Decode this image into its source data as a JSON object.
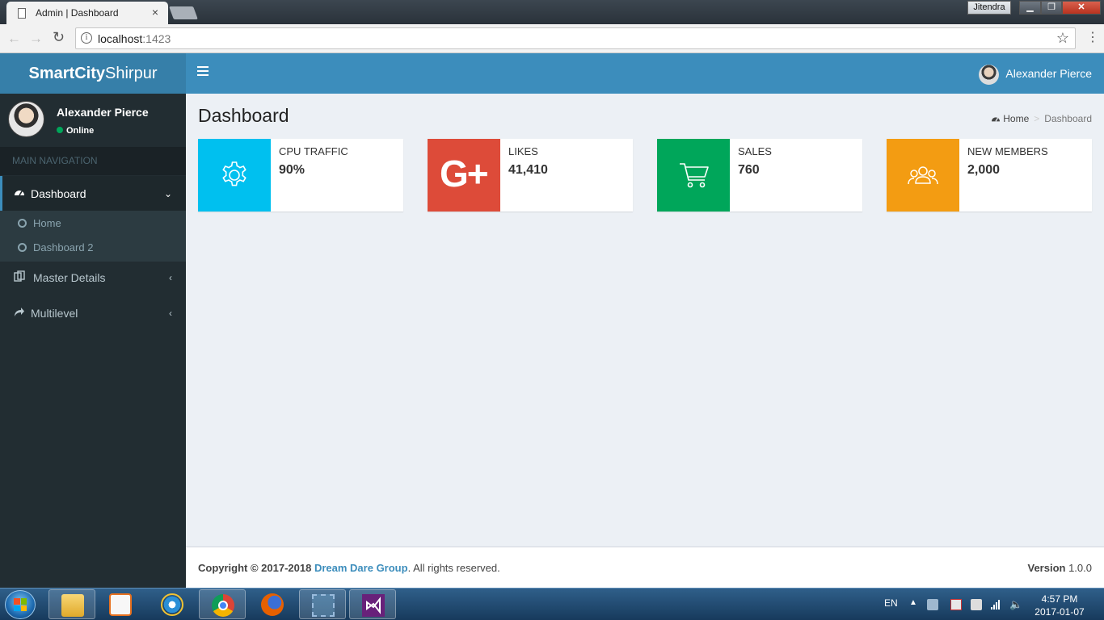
{
  "browser": {
    "tab_title": "Admin | Dashboard",
    "tab_close": "×",
    "url_host": "localhost",
    "url_port": ":1423",
    "window_user": "Jitendra"
  },
  "header": {
    "logo_bold": "SmartCity",
    "logo_light": "Shirpur",
    "user_name": "Alexander Pierce"
  },
  "sidebar": {
    "user_name": "Alexander Pierce",
    "user_status": "Online",
    "section_header": "MAIN NAVIGATION",
    "items": [
      {
        "label": "Dashboard",
        "icon": "dashboard-icon"
      },
      {
        "label": "Master Details",
        "icon": "copy-icon"
      },
      {
        "label": "Multilevel",
        "icon": "share-icon"
      }
    ],
    "subitems": [
      {
        "label": "Home"
      },
      {
        "label": "Dashboard 2"
      }
    ]
  },
  "content": {
    "title": "Dashboard",
    "breadcrumb": {
      "home": "Home",
      "current": "Dashboard"
    },
    "boxes": [
      {
        "label": "CPU TRAFFIC",
        "value": "90%",
        "color": "#00c0ef",
        "icon": "gear-icon"
      },
      {
        "label": "LIKES",
        "value": "41,410",
        "color": "#dd4b39",
        "icon": "google-plus-icon",
        "icon_text": "G+"
      },
      {
        "label": "SALES",
        "value": "760",
        "color": "#00a65a",
        "icon": "cart-icon"
      },
      {
        "label": "NEW MEMBERS",
        "value": "2,000",
        "color": "#f39c12",
        "icon": "users-icon"
      }
    ]
  },
  "footer": {
    "copyright": "Copyright © 2017-2018 ",
    "company": "Dream Dare Group",
    "rights": ". All rights reserved.",
    "version_label": "Version",
    "version_value": " 1.0.0"
  },
  "taskbar": {
    "lang": "EN",
    "time": "4:57 PM",
    "date": "2017-01-07"
  },
  "colors": {
    "primary": "#3c8dbc",
    "sidebar": "#222d32",
    "online": "#00a65a"
  }
}
